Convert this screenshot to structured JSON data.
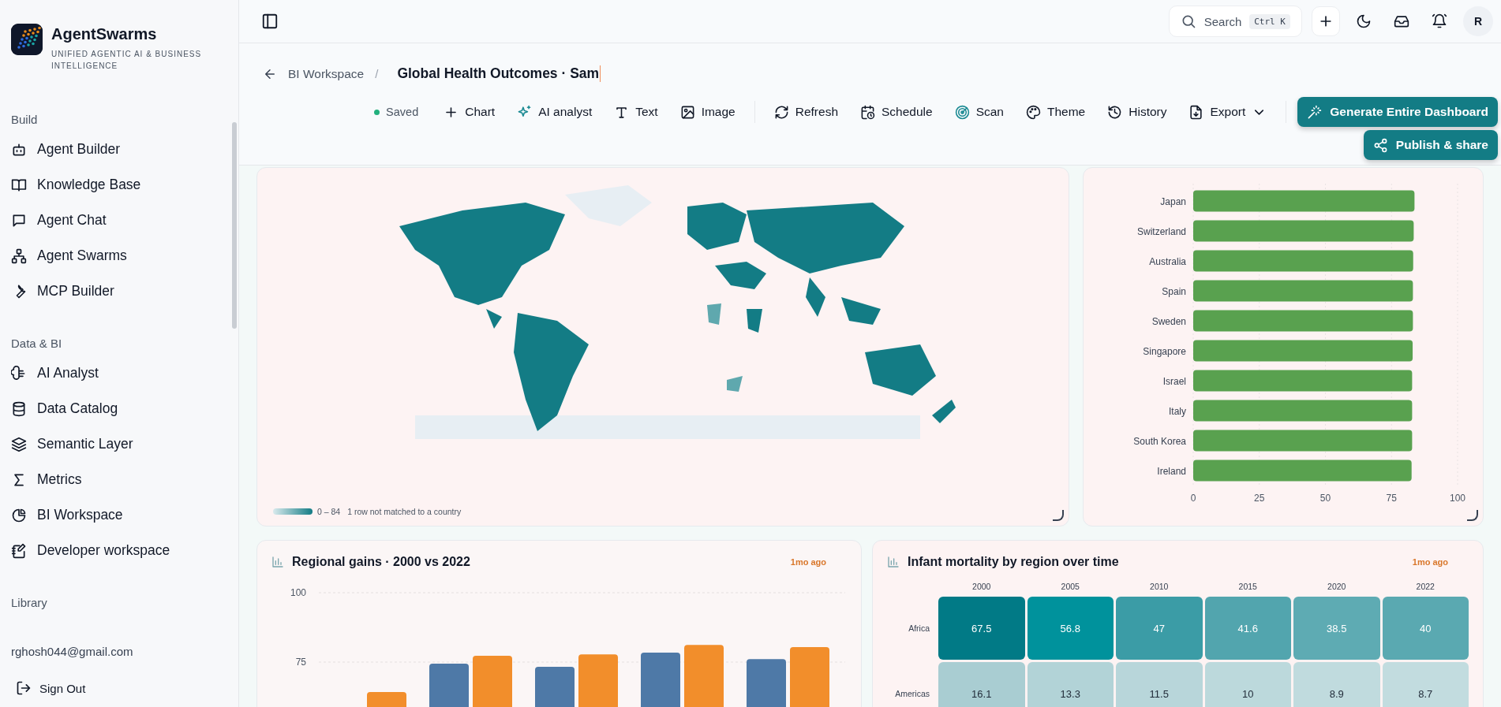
{
  "brand": {
    "name": "AgentSwarms",
    "tagline": "UNIFIED AGENTIC AI & BUSINESS INTELLIGENCE"
  },
  "sidebar": {
    "sections": [
      {
        "label": "Build",
        "items": [
          {
            "label": "Agent Builder",
            "selected": false
          },
          {
            "label": "Knowledge Base",
            "selected": false
          },
          {
            "label": "Agent Chat",
            "selected": false
          },
          {
            "label": "Agent Swarms",
            "selected": false
          },
          {
            "label": "MCP Builder",
            "selected": false
          }
        ]
      },
      {
        "label": "Data & BI",
        "items": [
          {
            "label": "AI Analyst",
            "selected": false
          },
          {
            "label": "Data Catalog",
            "selected": false
          },
          {
            "label": "Semantic Layer",
            "selected": false
          },
          {
            "label": "Metrics",
            "selected": false
          },
          {
            "label": "BI Workspace",
            "selected": false
          },
          {
            "label": "Developer workspace",
            "selected": false
          }
        ]
      },
      {
        "label": "Library"
      }
    ]
  },
  "user": {
    "email": "rghosh044@gmail.com",
    "sign_out": "Sign Out"
  },
  "topbar": {
    "search": {
      "placeholder": "Search",
      "shortcut": "Ctrl K"
    },
    "avatar": "R"
  },
  "breadcrumb": {
    "parent": "BI Workspace",
    "separator": "/",
    "title": "Global Health Outcomes · Sam"
  },
  "toolbar": {
    "status": "Saved",
    "actions": [
      {
        "label": "Chart",
        "dropdown": false
      },
      {
        "label": "AI analyst",
        "dropdown": false
      },
      {
        "label": "Text",
        "dropdown": false
      },
      {
        "label": "Image",
        "dropdown": false
      },
      {
        "label": "Refresh",
        "dropdown": false
      },
      {
        "label": "Schedule",
        "dropdown": false
      },
      {
        "label": "Scan",
        "dropdown": false
      },
      {
        "label": "Theme",
        "dropdown": false
      },
      {
        "label": "History",
        "dropdown": false
      },
      {
        "label": "Export",
        "dropdown": true
      }
    ],
    "primary": "Generate Entire Dashboard",
    "publish": "Publish & share"
  },
  "map_card": {
    "legend_range": "0 – 84",
    "note": "1 row not matched to a country"
  },
  "bar_card": {
    "chart_data": {
      "type": "bar",
      "orientation": "horizontal",
      "categories": [
        "Japan",
        "Switzerland",
        "Australia",
        "Spain",
        "Sweden",
        "Singapore",
        "Israel",
        "Italy",
        "South Korea",
        "Ireland"
      ],
      "values": [
        83.7,
        83.4,
        83.2,
        83.1,
        83.1,
        83.0,
        82.8,
        82.8,
        82.8,
        82.6
      ],
      "xlim": [
        0,
        100
      ],
      "xticks": [
        0,
        25,
        50,
        75,
        100
      ],
      "grid": true
    }
  },
  "gains_card": {
    "title": "Regional gains · 2000 vs 2022",
    "updated": "1mo ago",
    "chart_data": {
      "type": "bar",
      "series": [
        {
          "color": "#4e79a7",
          "values": [
            null,
            74.4,
            73.3,
            78.4,
            76.1
          ]
        },
        {
          "color": "#f28e2b",
          "values": [
            64.2,
            77.3,
            77.8,
            81.2,
            80.4
          ]
        }
      ],
      "ylim": [
        0,
        100
      ],
      "yticks": [
        75,
        100
      ],
      "grid": true
    }
  },
  "heatmap_card": {
    "title": "Infant mortality by region over time",
    "updated": "1mo ago",
    "columns": [
      "2000",
      "2005",
      "2010",
      "2015",
      "2020",
      "2022"
    ],
    "rows": [
      {
        "label": "Africa",
        "cells": [
          {
            "value": "67.5",
            "color": "#017a86"
          },
          {
            "value": "56.8",
            "color": "#00929c"
          },
          {
            "value": "47",
            "color": "#3b9ca6"
          },
          {
            "value": "41.6",
            "color": "#52a5ae"
          },
          {
            "value": "38.5",
            "color": "#5eabb3"
          },
          {
            "value": "40",
            "color": "#5aa9b1"
          }
        ]
      },
      {
        "label": "Americas",
        "cells": [
          {
            "value": "16.1",
            "color": "#a9cdd2"
          },
          {
            "value": "13.3",
            "color": "#b2d3d7"
          },
          {
            "value": "11.5",
            "color": "#b8d6da"
          },
          {
            "value": "10",
            "color": "#bcd9dc"
          },
          {
            "value": "8.9",
            "color": "#c0dbde"
          },
          {
            "value": "8.7",
            "color": "#c2dcdf"
          }
        ]
      }
    ]
  }
}
